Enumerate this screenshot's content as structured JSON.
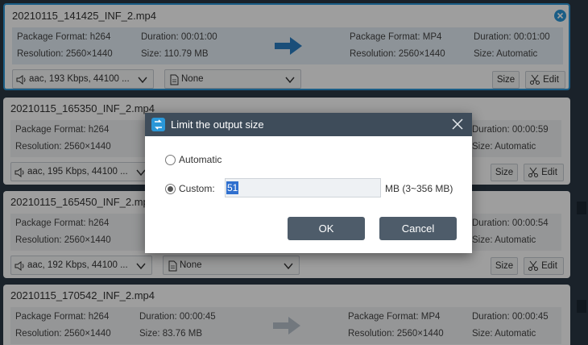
{
  "cards": [
    {
      "filename": "20210115_141425_INF_2.mp4",
      "src_format": "Package Format: h264",
      "src_duration": "Duration: 00:01:00",
      "src_resolution": "Resolution: 2560×1440",
      "src_size": "Size: 110.79 MB",
      "out_format": "Package Format: MP4",
      "out_duration": "Duration: 00:01:00",
      "out_resolution": "Resolution: 2560×1440",
      "out_size": "Size: Automatic",
      "audio": "aac, 193 Kbps, 44100 ...",
      "subtitle": "None",
      "size_btn": "Size",
      "edit_btn": "Edit"
    },
    {
      "filename": "20210115_165350_INF_2.mp4",
      "src_format": "Package Format: h264",
      "src_resolution": "Resolution: 2560×1440",
      "out_duration": "Duration: 00:00:59",
      "out_size": "Size: Automatic",
      "audio": "aac, 195 Kbps, 44100 ...",
      "size_btn": "Size",
      "edit_btn": "Edit"
    },
    {
      "filename": "20210115_165450_INF_2.mp4",
      "src_format": "Package Format: h264",
      "src_resolution": "Resolution: 2560×1440",
      "out_duration": "Duration: 00:00:54",
      "out_size": "Size: Automatic",
      "audio": "aac, 192 Kbps, 44100 ...",
      "subtitle": "None",
      "size_btn": "Size",
      "edit_btn": "Edit"
    },
    {
      "filename": "20210115_170542_INF_2.mp4",
      "src_format": "Package Format: h264",
      "src_duration": "Duration: 00:00:45",
      "src_resolution": "Resolution: 2560×1440",
      "src_size": "Size: 83.76 MB",
      "out_format": "Package Format: MP4",
      "out_duration": "Duration: 00:00:45",
      "out_resolution": "Resolution: 2560×1440",
      "out_size": "Size: Automatic"
    }
  ],
  "dialog": {
    "title": "Limit the output size",
    "option_automatic": "Automatic",
    "option_custom": "Custom:",
    "custom_value": "51",
    "unit_range": "MB (3~356 MB)",
    "ok": "OK",
    "cancel": "Cancel"
  },
  "colors": {
    "accent": "#2a97d8",
    "dialog_header": "#3e4c5a",
    "button": "#4e5c6a"
  }
}
